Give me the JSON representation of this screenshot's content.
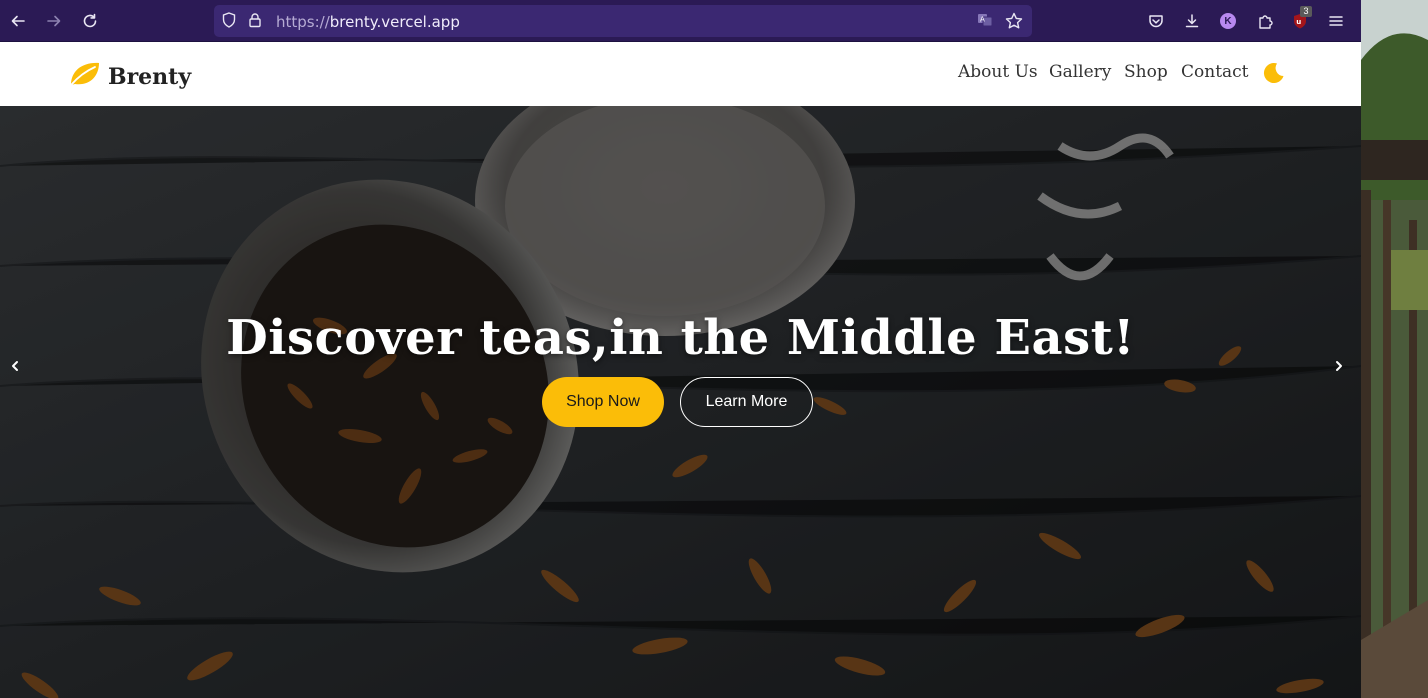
{
  "browser": {
    "url_protocol": "https://",
    "url_host": "brenty.vercel.app",
    "profile_initial": "K",
    "extension_badge": "3"
  },
  "site": {
    "brand": "Brenty",
    "nav": [
      "About Us",
      "Gallery",
      "Shop",
      "Contact"
    ],
    "accent_color": "#fbbd08"
  },
  "hero": {
    "title": "Discover teas,in the Middle East!",
    "primary_button": "Shop Now",
    "secondary_button": "Learn More"
  },
  "icons": {
    "back": "arrow-left-icon",
    "forward": "arrow-right-icon",
    "reload": "reload-icon",
    "tracking": "shield-icon",
    "lock": "lock-icon",
    "translate": "translate-icon",
    "bookmark": "star-icon",
    "pocket": "pocket-icon",
    "download": "download-icon",
    "extensions": "puzzle-icon",
    "menu": "hamburger-icon",
    "logo": "leaf-icon",
    "theme": "moon-icon",
    "prev": "chevron-left-icon",
    "next": "chevron-right-icon"
  }
}
